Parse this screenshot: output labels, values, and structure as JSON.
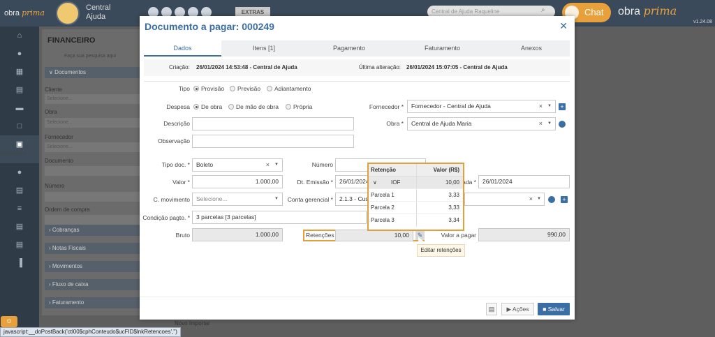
{
  "app": {
    "logo_text": "obra",
    "logo_accent": "prima",
    "account_line1": "Central",
    "account_line2": "Ajuda",
    "extras_label": "EXTRAS",
    "search_placeholder": "Central de Ajuda Raqueline",
    "chat_label": "Chat",
    "brand_right": "obra",
    "brand_right_accent": "prima",
    "version": "v1.24.08",
    "nav_active_label": "FINANCEIRO",
    "status_url": "javascript:__doPostBack('ctl00$cphConteudo$ucFID$lnkRetencoes','')",
    "bottom_actions": "Novo    Importar"
  },
  "panel": {
    "title": "FINANCEIRO",
    "search_hint": "Faça sua pesquisa aqui",
    "section_documentos": "Documentos",
    "fields": [
      {
        "label": "Cliente",
        "placeholder": "Selecione..."
      },
      {
        "label": "Obra",
        "placeholder": "Selecione..."
      },
      {
        "label": "Fornecedor",
        "placeholder": "Selecione..."
      },
      {
        "label": "Documento",
        "placeholder": ""
      },
      {
        "label": "Número",
        "placeholder": ""
      },
      {
        "label": "Ordem de compra",
        "placeholder": ""
      }
    ],
    "sections": [
      "Cobranças",
      "Notas Fiscais",
      "Movimentos",
      "Fluxo de caixa",
      "Faturamento"
    ]
  },
  "modal": {
    "title": "Documento a pagar: 000249",
    "tabs": [
      "Dados",
      "Itens [1]",
      "Pagamento",
      "Faturamento",
      "Anexos"
    ],
    "created_label": "Criação:",
    "created_value": "26/01/2024 14:53:48 - Central de Ajuda",
    "modified_label": "Última alteração:",
    "modified_value": "26/01/2024 15:07:05 - Central de Ajuda",
    "tipo_label": "Tipo",
    "tipo_options": [
      "Provisão",
      "Previsão",
      "Adiantamento"
    ],
    "despesa_label": "Despesa",
    "despesa_options": [
      "De obra",
      "De mão de obra",
      "Própria"
    ],
    "fornecedor_label": "Fornecedor *",
    "fornecedor_value": "Fornecedor - Central de Ajuda",
    "descricao_label": "Descrição",
    "obra_label": "Obra *",
    "obra_value": "Central de Ajuda Maria",
    "observacao_label": "Observação",
    "tipo_doc_label": "Tipo doc. *",
    "tipo_doc_value": "Boleto",
    "numero_label": "Número",
    "valor_label": "Valor *",
    "valor_value": "1.000,00",
    "dt_emissao_label": "Dt. Emissão *",
    "dt_emissao_value": "26/01/2024",
    "dt_entrada_label": "ada *",
    "dt_entrada_value": "26/01/2024",
    "c_movimento_label": "C. movimento",
    "c_movimento_placeholder": "Selecione...",
    "conta_gerencial_label": "Conta gerencial *",
    "conta_gerencial_value": "2.1.3 - Cus",
    "condicao_label": "Condição pagto. *",
    "condicao_value": "3 parcelas [3 parcelas]",
    "bruto_label": "Bruto",
    "bruto_value": "1.000,00",
    "retencoes_label": "Retenções",
    "retencoes_value": "10,00",
    "valor_pagar_label": "Valor a pagar",
    "valor_pagar_value": "990,00",
    "tooltip": "Editar retenções",
    "acoes_label": "Ações",
    "salvar_label": "Salvar"
  },
  "retencoes_table": {
    "headers": [
      "Retenção",
      "Valor (R$)"
    ],
    "rows": [
      {
        "name": "IOF",
        "value": "10,00"
      },
      {
        "name": "Parcela 1",
        "value": "3,33"
      },
      {
        "name": "Parcela 2",
        "value": "3,33"
      },
      {
        "name": "Parcela 3",
        "value": "3,34"
      }
    ]
  },
  "colors": {
    "accent": "#3a6ea5",
    "highlight": "#e0a13b",
    "chat": "#e8a13a"
  }
}
